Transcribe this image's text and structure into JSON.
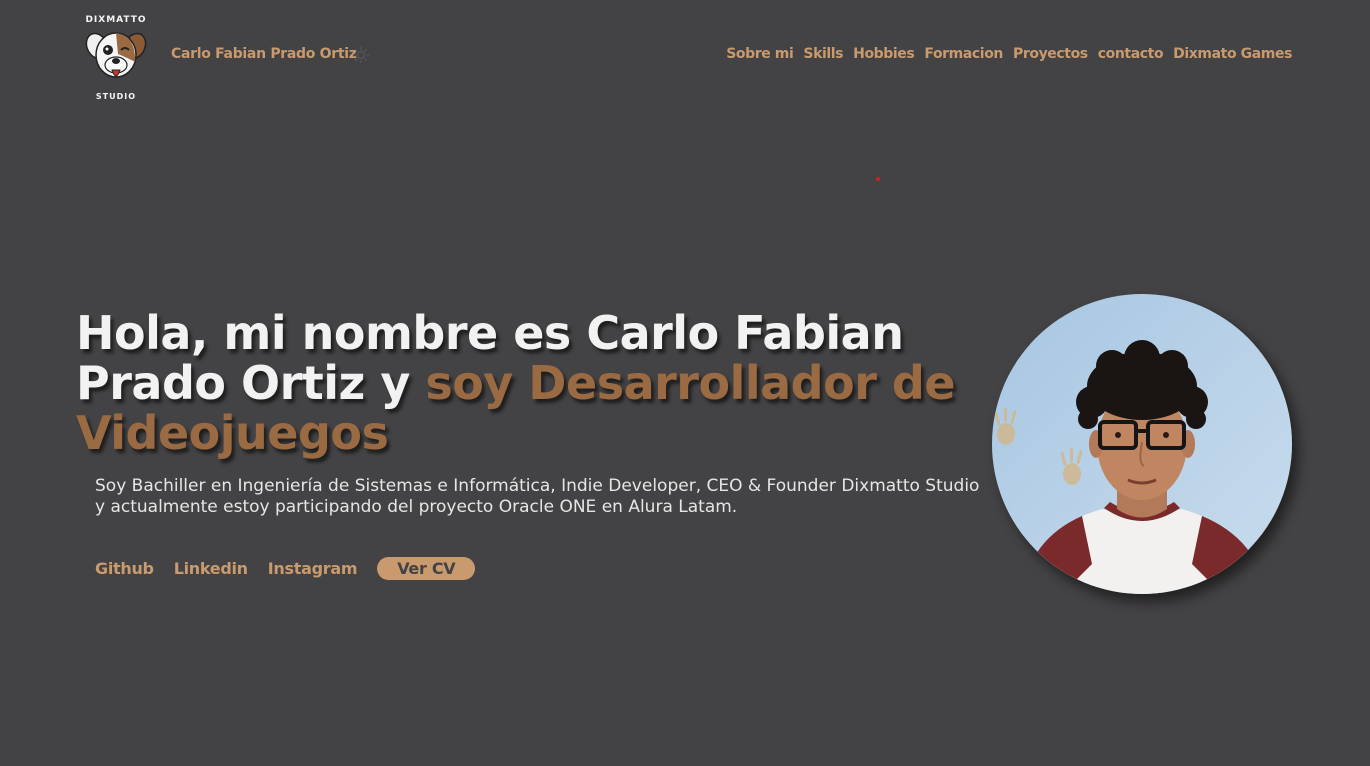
{
  "header": {
    "site_name": "Carlo Fabian Prado Ortiz",
    "logo": {
      "top_text": "DIXMATTO",
      "bottom_text": "STUDIO"
    },
    "nav": [
      {
        "label": "Sobre mi"
      },
      {
        "label": "Skills"
      },
      {
        "label": "Hobbies"
      },
      {
        "label": "Formacion"
      },
      {
        "label": "Proyectos"
      },
      {
        "label": "contacto"
      },
      {
        "label": "Dixmato Games"
      }
    ]
  },
  "hero": {
    "title_part1": "Hola, mi nombre es Carlo Fabian Prado Ortiz y ",
    "title_accent": "soy Desarrollador de Videojuegos",
    "description": "Soy Bachiller en Ingeniería de Sistemas e Informática, Indie Developer, CEO & Founder Dixmatto Studio y actualmente estoy participando del proyecto Oracle ONE en Alura Latam.",
    "links": {
      "github": "Github",
      "linkedin": "Linkedin",
      "instagram": "Instagram",
      "cv": "Ver CV"
    }
  },
  "colors": {
    "background": "#434244",
    "accent": "#c89a6e",
    "title_accent": "#9a6a42",
    "title": "#f2f2f2"
  }
}
